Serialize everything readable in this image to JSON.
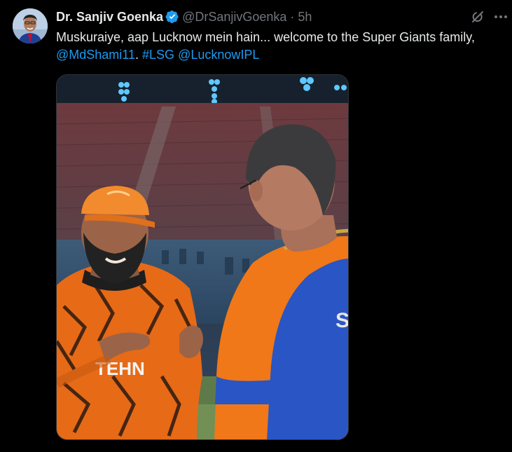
{
  "tweet": {
    "author": {
      "name": "Dr. Sanjiv Goenka",
      "handle": "@DrSanjivGoenka",
      "separator": "·",
      "timestamp": "5h",
      "verified": true,
      "verified_color": "#1d9bf0",
      "avatar_icon": "profile-photo"
    },
    "text": {
      "line1": "Muskuraiye, aap Lucknow mein hain... welcome to the Super Giants family,",
      "mention_shami": "@MdShami11",
      "after_mention": ".",
      "hashtag": "#LSG",
      "mention_lucknow": "@LucknowIPL"
    },
    "actions": {
      "grok_icon": "grok-icon",
      "more_icon": "more-options-icon"
    },
    "media": {
      "type": "photo",
      "jersey_text_left": "TEHN",
      "jersey_text_right": "SI"
    },
    "colors": {
      "background": "#000000",
      "text": "#e7e9ea",
      "secondary": "#71767b",
      "link": "#1d9bf0",
      "border": "#2f3336"
    }
  }
}
